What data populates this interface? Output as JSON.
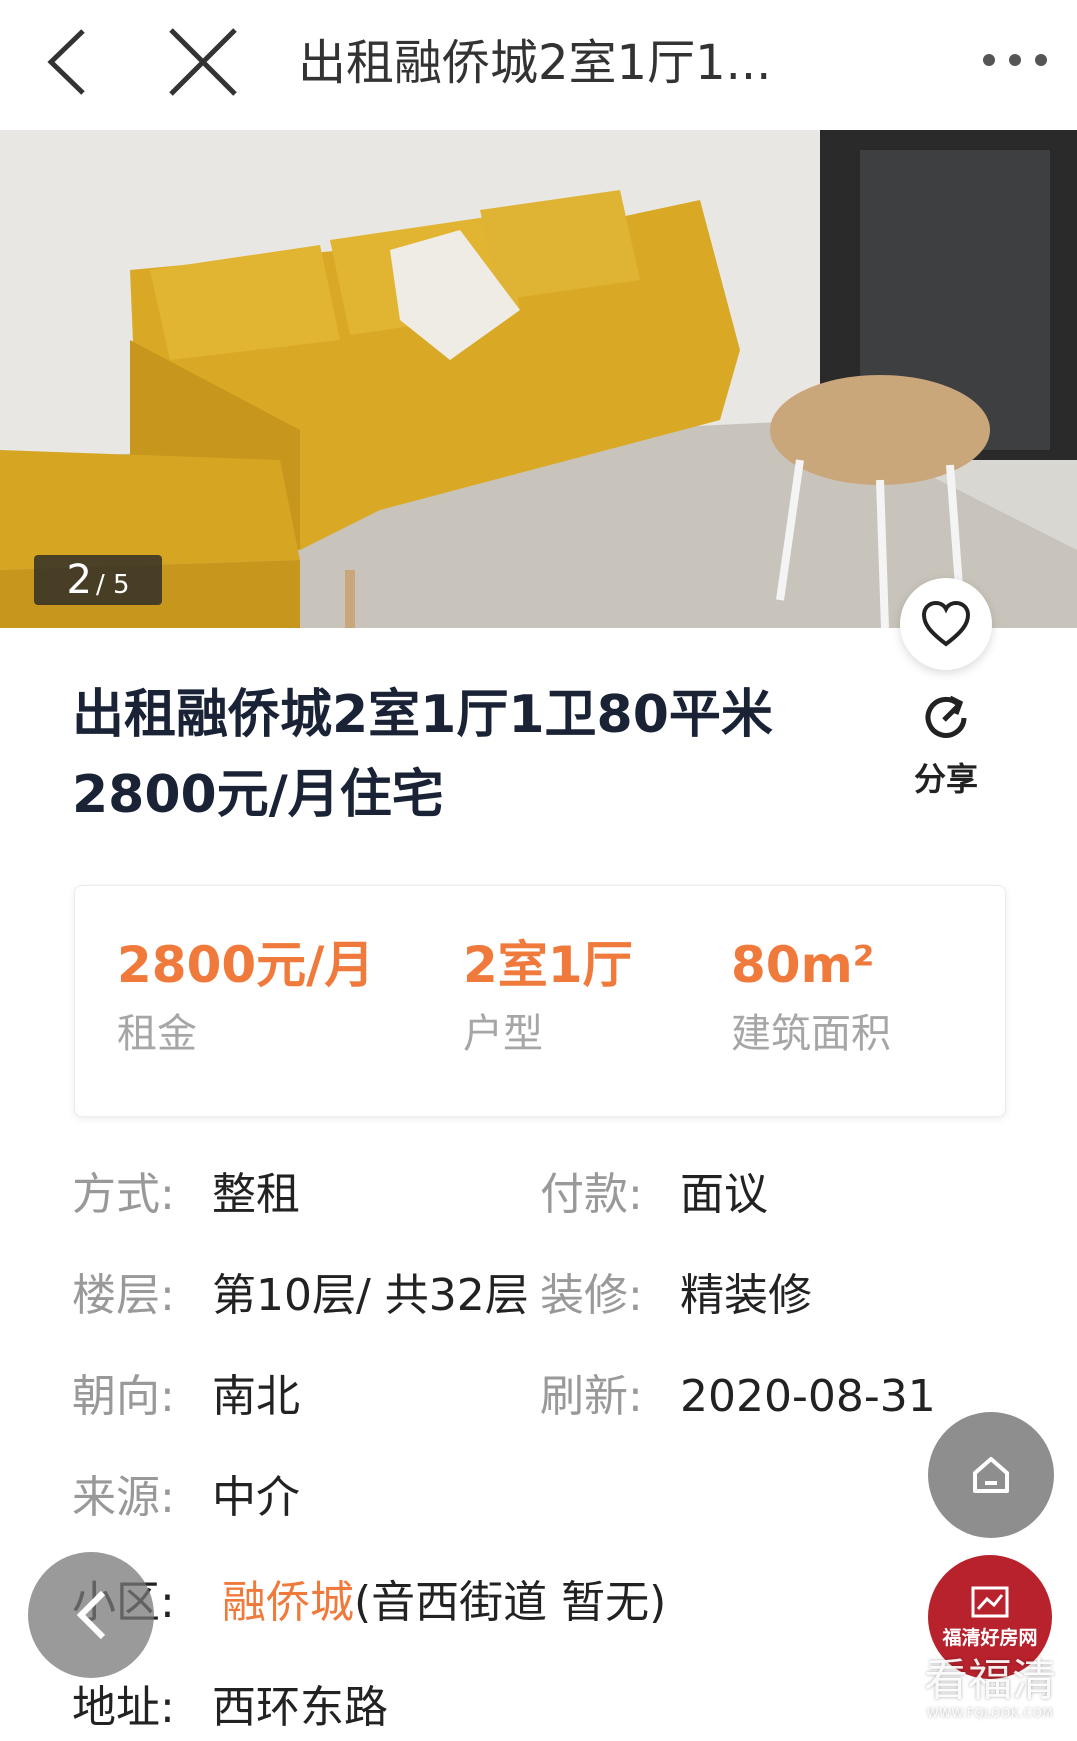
{
  "nav": {
    "title": "出租融侨城2室1厅1..."
  },
  "photo": {
    "current": "2",
    "total": "/ 5"
  },
  "listing": {
    "title": "出租融侨城2室1厅1卫80平米2800元/月住宅",
    "share_label": "分享"
  },
  "summary": [
    {
      "value": "2800元/月",
      "label": "租金"
    },
    {
      "value": "2室1厅",
      "label": "户型"
    },
    {
      "value": "80m²",
      "label": "建筑面积"
    }
  ],
  "details": {
    "mode": {
      "label": "方式:",
      "value": "整租"
    },
    "payment": {
      "label": "付款:",
      "value": "面议"
    },
    "floor": {
      "label": "楼层:",
      "value": "第10层/ 共32层"
    },
    "decoration": {
      "label": "装修:",
      "value": "精装修"
    },
    "orientation": {
      "label": "朝向:",
      "value": "南北"
    },
    "refresh": {
      "label": "刷新:",
      "value": "2020-08-31"
    },
    "source": {
      "label": "来源:",
      "value": "中介"
    },
    "community": {
      "label": "小区:",
      "link": "融侨城",
      "extra": "(音西街道 暂无)"
    },
    "address": {
      "label": "地址:",
      "value": "西环东路"
    }
  },
  "brand": {
    "logo_text": "福清好房网",
    "watermark": "看福清",
    "watermark_url": "WWW.FQLOOK.COM"
  },
  "colors": {
    "accent": "#f07a3c",
    "title": "#1a2236",
    "label": "#999999",
    "brand_red": "#b8222c"
  },
  "icons": [
    "back-arrow-icon",
    "close-icon",
    "more-dots-icon",
    "heart-icon",
    "share-icon",
    "home-icon",
    "prev-arrow-icon",
    "house-photo-icon"
  ]
}
